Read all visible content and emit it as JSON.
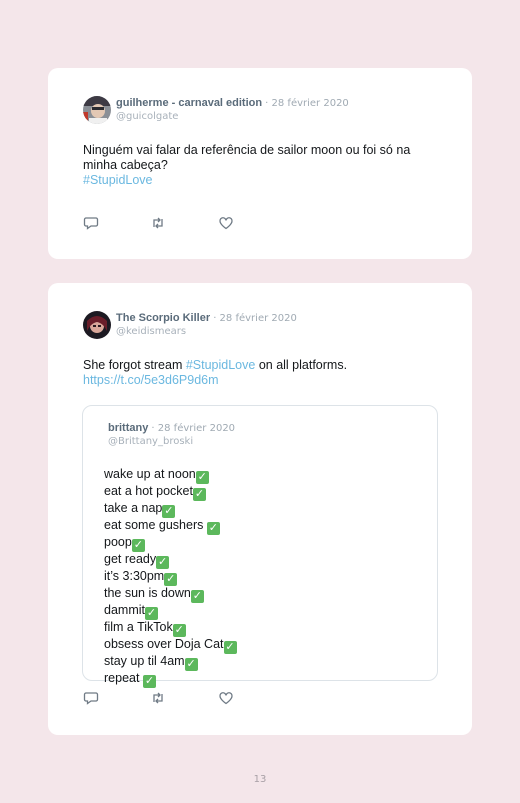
{
  "tweets": [
    {
      "name": "guilherme - carnaval edition",
      "date": "· 28 février 2020",
      "handle": "@guicolgate",
      "text_line1": "Ninguém vai falar da referência de sailor moon ou foi só na",
      "text_line2": "minha cabeça?",
      "hashtag": "#StupidLove",
      "actions": [
        "reply-icon",
        "retweet-icon",
        "like-icon"
      ]
    },
    {
      "name": "The Scorpio Killer",
      "date": "· 28 février 2020",
      "handle": "@keidismears",
      "text_before": "She forgot stream ",
      "hashtag": "#StupidLove",
      "text_after": " on all platforms.",
      "link": "https://t.co/5e3d6P9d6m",
      "quoted": {
        "name": "brittany",
        "date": "· 28 février 2020",
        "handle": "@Brittany_broski",
        "lines": [
          "wake up at noon",
          "eat a hot pocket",
          "take a nap",
          "eat some gushers ",
          "poop",
          "get ready",
          "it’s 3:30pm",
          "the sun is down",
          "dammit",
          "film a TikTok",
          "obsess over Doja Cat",
          "stay up til 4am",
          "repeat "
        ],
        "check_glyph": "✓"
      },
      "actions": [
        "reply-icon",
        "retweet-icon",
        "like-icon"
      ]
    }
  ],
  "page_number": "13",
  "colors": {
    "background": "#f4e6ea",
    "card": "#ffffff",
    "link": "#6bb8e0",
    "check": "#5cb85c"
  }
}
